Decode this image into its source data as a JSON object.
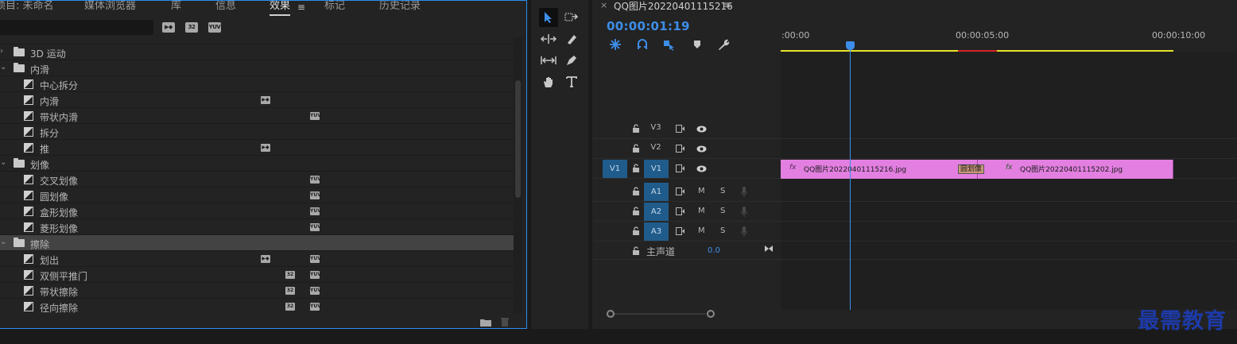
{
  "effects_panel": {
    "tabs": [
      {
        "label": "项目: 未命名"
      },
      {
        "label": "媒体浏览器"
      },
      {
        "label": "库"
      },
      {
        "label": "信息"
      },
      {
        "label": "效果",
        "active": true
      },
      {
        "label": "标记"
      },
      {
        "label": "历史记录"
      }
    ],
    "tab_menu_icon": "≡",
    "toggle_icons": [
      "accelerated-effects-icon",
      "32-bit-color-icon",
      "yuv-effects-icon"
    ],
    "toggle_labels": [
      "▶◆",
      "32",
      "YUV"
    ],
    "tree": [
      {
        "type": "folder",
        "label": "3D 运动",
        "expanded": false
      },
      {
        "type": "folder",
        "label": "内滑",
        "expanded": true
      },
      {
        "type": "effect",
        "label": "中心拆分",
        "badges": []
      },
      {
        "type": "effect",
        "label": "内滑",
        "badges": [
          "accel"
        ]
      },
      {
        "type": "effect",
        "label": "带状内滑",
        "badges": [
          "yuv"
        ]
      },
      {
        "type": "effect",
        "label": "拆分",
        "badges": []
      },
      {
        "type": "effect",
        "label": "推",
        "badges": [
          "accel"
        ]
      },
      {
        "type": "folder",
        "label": "划像",
        "expanded": true
      },
      {
        "type": "effect",
        "label": "交叉划像",
        "badges": [
          "yuv"
        ]
      },
      {
        "type": "effect",
        "label": "圆划像",
        "badges": [
          "yuv"
        ]
      },
      {
        "type": "effect",
        "label": "盒形划像",
        "badges": [
          "yuv"
        ]
      },
      {
        "type": "effect",
        "label": "菱形划像",
        "badges": [
          "yuv"
        ]
      },
      {
        "type": "folder",
        "label": "擦除",
        "expanded": true,
        "selected": true
      },
      {
        "type": "effect",
        "label": "划出",
        "badges": [
          "accel",
          "yuv"
        ]
      },
      {
        "type": "effect",
        "label": "双侧平推门",
        "badges": [
          "32",
          "yuv"
        ]
      },
      {
        "type": "effect",
        "label": "带状擦除",
        "badges": [
          "32",
          "yuv"
        ]
      },
      {
        "type": "effect",
        "label": "径向擦除",
        "badges": [
          "32",
          "yuv"
        ]
      }
    ]
  },
  "tools": [
    "selection-tool-icon",
    "track-select-forward-icon",
    "ripple-edit-icon",
    "razor-icon",
    "slip-icon",
    "pen-icon",
    "hand-icon",
    "type-icon"
  ],
  "timeline": {
    "close_icon": "×",
    "title": "QQ图片20220401115216",
    "menu_icon": "≡",
    "timecode": "00:00:01:19",
    "ruler_labels": [
      ":00:00",
      "00:00:05:00",
      "00:00:10:00"
    ],
    "tracks": {
      "video": [
        {
          "name": "V3",
          "source": ""
        },
        {
          "name": "V2",
          "source": ""
        },
        {
          "name": "V1",
          "source": "V1"
        }
      ],
      "audio": [
        {
          "name": "A1",
          "m": "M",
          "s": "S"
        },
        {
          "name": "A2",
          "m": "M",
          "s": "S"
        },
        {
          "name": "A3",
          "m": "M",
          "s": "S"
        }
      ],
      "master": {
        "label": "主声道",
        "value": "0.0"
      }
    },
    "clips": [
      {
        "fx": "fx",
        "name": "QQ图片20220401115216.jpg"
      },
      {
        "fx": "fx",
        "name": "QQ图片20220401115202.jpg"
      }
    ],
    "transition": "圆划像"
  },
  "watermark": "最需教育",
  "colors": {
    "accent": "#3d8ee8",
    "clip": "#e27fe0",
    "work_area": "#e8e22a",
    "render_red": "#d82222"
  }
}
